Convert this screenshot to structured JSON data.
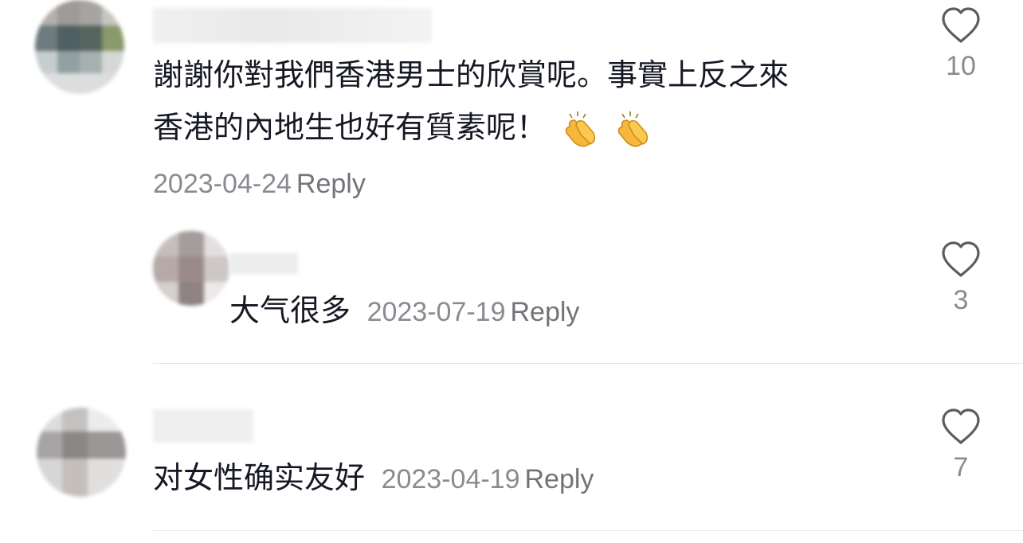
{
  "comments": [
    {
      "text_line1": "謝謝你對我們香港男士的欣賞呢。事實上反之來",
      "text_line2": "香港的內地生也好有質素呢！",
      "emoji": "clapping-hands-icon",
      "date": "2023-04-24",
      "reply_label": "Reply",
      "likes": "10"
    },
    {
      "text": "大气很多",
      "date": "2023-07-19",
      "reply_label": "Reply",
      "likes": "3"
    },
    {
      "text": "对女性确实友好",
      "date": "2023-04-19",
      "reply_label": "Reply",
      "likes": "7"
    }
  ],
  "colors": {
    "text": "#161823",
    "meta": "#8a8b91",
    "divider": "#e6e6e8",
    "emoji": "#f6b73c"
  }
}
